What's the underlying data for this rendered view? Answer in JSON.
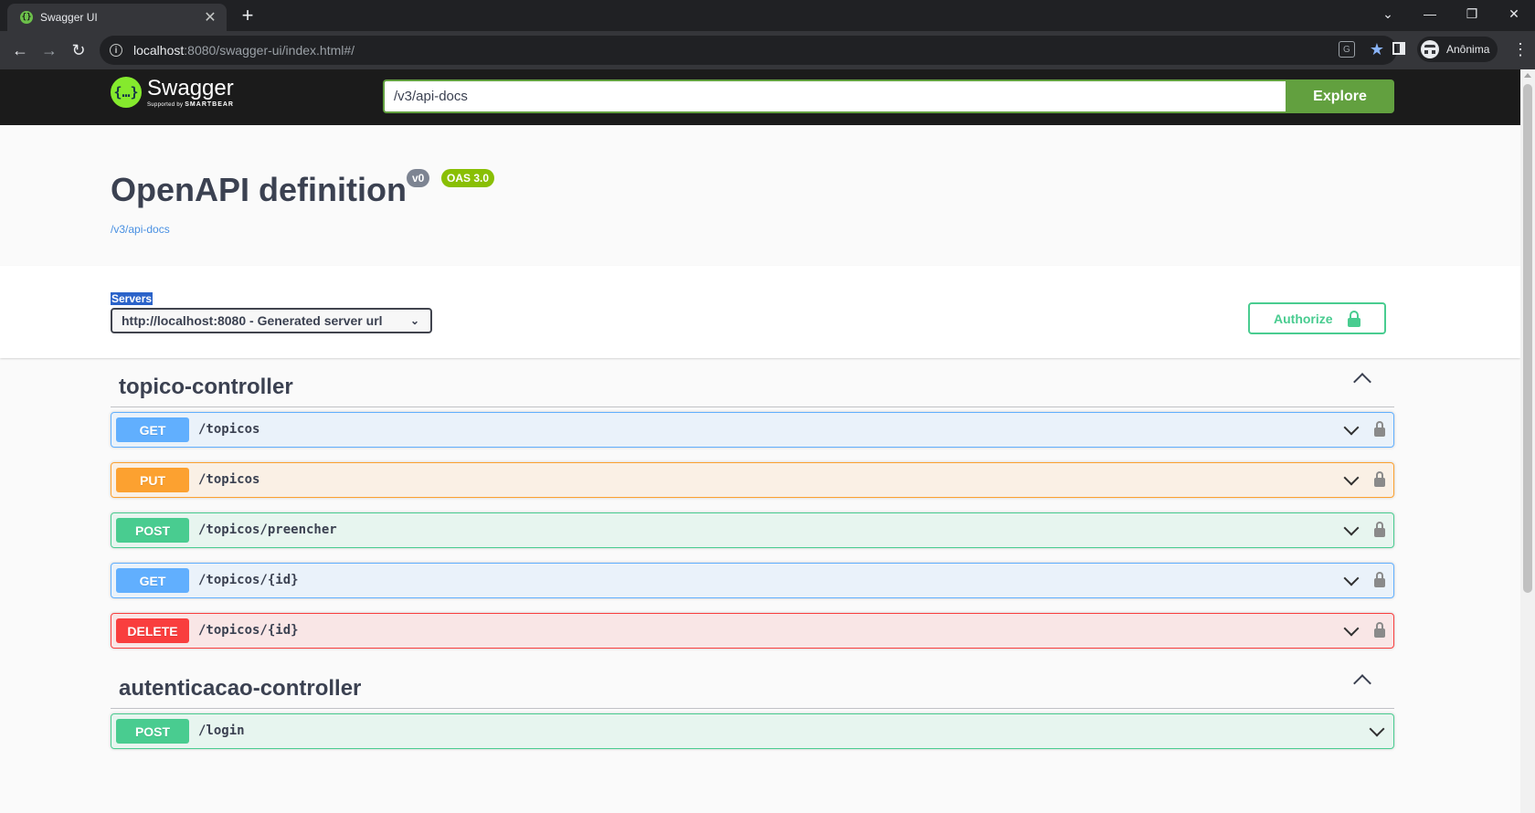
{
  "browser": {
    "tab_title": "Swagger UI",
    "tab_close": "✕",
    "new_tab": "+",
    "url_host": "localhost",
    "url_rest": ":8080/swagger-ui/index.html#/",
    "profile_label": "Anônima"
  },
  "swagger": {
    "logo_name": "Swagger",
    "logo_supported_by": "Supported by",
    "logo_smartbear": "SMARTBEAR",
    "api_url_value": "/v3/api-docs",
    "explore_label": "Explore"
  },
  "info": {
    "title": "OpenAPI definition",
    "version_badge": "v0",
    "oas_badge": "OAS 3.0",
    "spec_link": "/v3/api-docs"
  },
  "servers": {
    "label": "Servers",
    "selected": "http://localhost:8080 - Generated server url",
    "authorize_label": "Authorize"
  },
  "tags": [
    {
      "name": "topico-controller",
      "operations": [
        {
          "method": "GET",
          "path": "/topicos"
        },
        {
          "method": "PUT",
          "path": "/topicos"
        },
        {
          "method": "POST",
          "path": "/topicos/preencher"
        },
        {
          "method": "GET",
          "path": "/topicos/{id}"
        },
        {
          "method": "DELETE",
          "path": "/topicos/{id}"
        }
      ]
    },
    {
      "name": "autenticacao-controller",
      "operations": [
        {
          "method": "POST",
          "path": "/login"
        }
      ]
    }
  ],
  "colors": {
    "get": "#61affe",
    "put": "#fca130",
    "post": "#49cc90",
    "delete": "#f93e3e",
    "topbar": "#1b1b1b",
    "explore": "#62a03f"
  }
}
